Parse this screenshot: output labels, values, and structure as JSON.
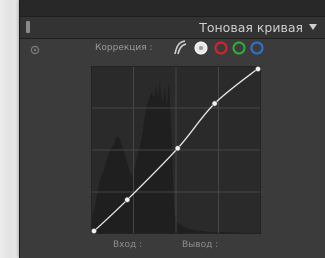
{
  "panel": {
    "title": "Тоновая кривая",
    "handle_icon": "panel-handle-icon",
    "collapse_icon": "triangle-down-icon"
  },
  "target_tool": {
    "icon": "target-adjust-icon"
  },
  "correction": {
    "label": "Коррекция :",
    "channels": [
      {
        "name": "point-curve",
        "icon": "point-curve-icon",
        "color": "#d0d0d0"
      },
      {
        "name": "rgb",
        "icon": "filled-circle-icon",
        "color": "#e8e8e8",
        "selected": true
      },
      {
        "name": "red",
        "icon": "ring-icon",
        "color": "#d8242c"
      },
      {
        "name": "green",
        "icon": "ring-icon",
        "color": "#2fae3c"
      },
      {
        "name": "blue",
        "icon": "ring-icon",
        "color": "#2e73cf"
      }
    ]
  },
  "curve": {
    "input_label": "Вход :",
    "output_label": "Вывод :",
    "control_points": [
      {
        "in": 0,
        "out": 0
      },
      {
        "in": 21,
        "out": 20
      },
      {
        "in": 51,
        "out": 51
      },
      {
        "in": 73,
        "out": 78
      },
      {
        "in": 100,
        "out": 100
      }
    ]
  },
  "colors": {
    "panel_bg": "#3b3b3b",
    "graph_bg": "#2a2a2a",
    "histogram": "#202020",
    "grid": "#4a4a4a",
    "curve": "#e6e6e6"
  }
}
